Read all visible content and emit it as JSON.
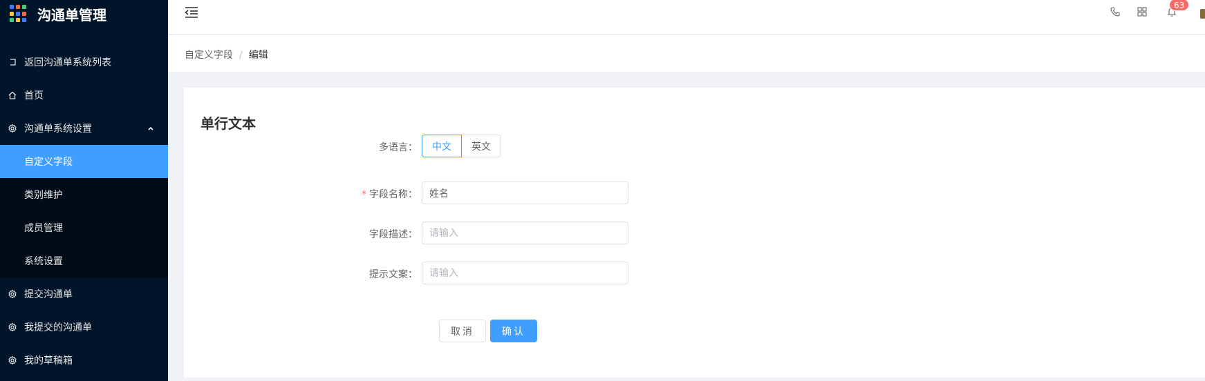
{
  "app": {
    "title": "沟通单管理",
    "brand_colors": [
      "#3a7bff",
      "#ff6b3d",
      "#3ccf7e",
      "#ffc53d",
      "#3a7bff",
      "#ff6b3d",
      "#3ccf7e",
      "#ffc53d",
      "#3a7bff"
    ]
  },
  "sidebar": {
    "items": [
      {
        "label": "返回沟通单系统列表",
        "icon": "back-icon"
      },
      {
        "label": "首页",
        "icon": "home-icon"
      },
      {
        "label": "沟通单系统设置",
        "icon": "gear-icon",
        "expanded": true
      },
      {
        "label": "自定义字段",
        "active": true
      },
      {
        "label": "类别维护"
      },
      {
        "label": "成员管理"
      },
      {
        "label": "系统设置"
      },
      {
        "label": "提交沟通单",
        "icon": "gear-icon"
      },
      {
        "label": "我提交的沟通单",
        "icon": "gear-icon"
      },
      {
        "label": "我的草稿箱",
        "icon": "gear-icon"
      }
    ]
  },
  "header": {
    "notification_count": "63",
    "icons": [
      "menu-fold-icon",
      "phone-icon",
      "grid-icon",
      "bell-icon"
    ]
  },
  "breadcrumb": {
    "parent": "自定义字段",
    "separator": "/",
    "current": "编辑"
  },
  "form": {
    "title": "单行文本",
    "language_label": "多语言：",
    "language_options": [
      "中文",
      "英文"
    ],
    "language_selected": "中文",
    "field_name_label": "字段名称：",
    "field_name_value": "姓名",
    "field_desc_label": "字段描述：",
    "field_desc_placeholder": "请输入",
    "hint_label": "提示文案：",
    "hint_placeholder": "请输入",
    "cancel_label": "取消",
    "confirm_label": "确认"
  },
  "colors": {
    "sidebar_bg": "#001529",
    "accent": "#409eff",
    "danger": "#f56c6c"
  }
}
